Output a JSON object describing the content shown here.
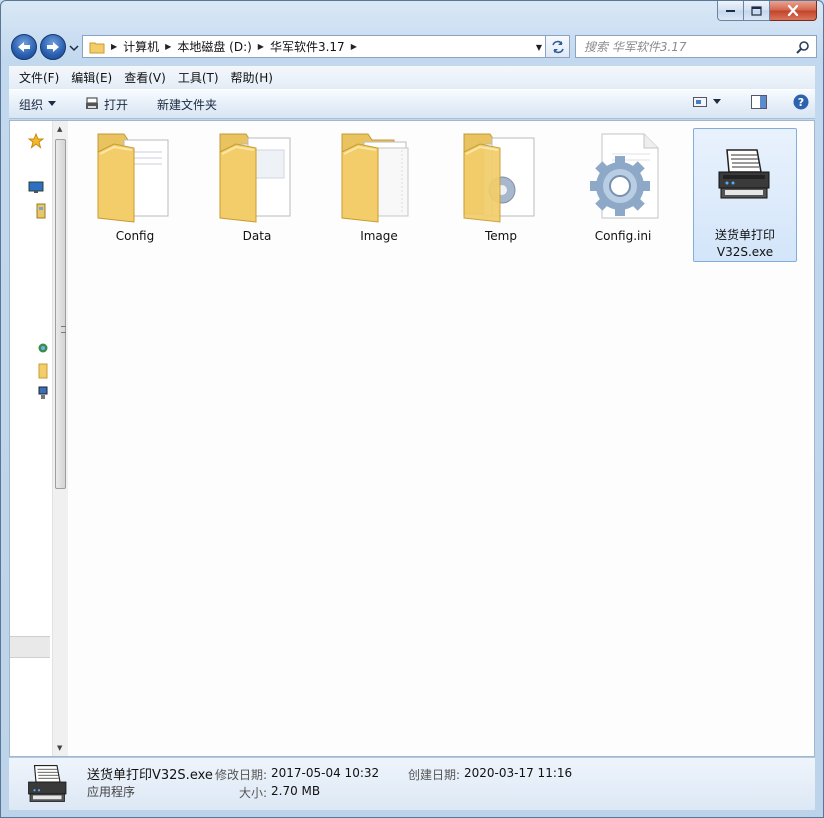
{
  "window": {
    "caption_buttons": [
      "minimize",
      "maximize",
      "close"
    ]
  },
  "address": {
    "crumbs": [
      "计算机",
      "本地磁盘 (D:)",
      "华军软件3.17"
    ]
  },
  "search": {
    "placeholder": "搜索 华军软件3.17"
  },
  "menu": [
    "文件(F)",
    "编辑(E)",
    "查看(V)",
    "工具(T)",
    "帮助(H)"
  ],
  "toolbar": {
    "organize": "组织",
    "open": "打开",
    "new_folder": "新建文件夹"
  },
  "files": [
    {
      "name": "Config",
      "kind": "folder",
      "icon": "folder-icon"
    },
    {
      "name": "Data",
      "kind": "folder",
      "icon": "folder-icon"
    },
    {
      "name": "Image",
      "kind": "folder",
      "icon": "folder-icon"
    },
    {
      "name": "Temp",
      "kind": "folder",
      "icon": "folder-gear-icon"
    },
    {
      "name": "Config.ini",
      "kind": "file",
      "icon": "settings-file-icon"
    },
    {
      "name": "送货单打印V32S.exe",
      "kind": "exe",
      "icon": "printer-icon",
      "selected": true
    }
  ],
  "details": {
    "name": "送货单打印V32S.exe",
    "type": "应用程序",
    "modified_label": "修改日期:",
    "modified": "2017-05-04 10:32",
    "created_label": "创建日期:",
    "created": "2020-03-17 11:16",
    "size_label": "大小:",
    "size": "2.70 MB"
  },
  "colors": {
    "selection_bg": "#d3e5fa",
    "selection_border": "#84acdd",
    "folder": "#f2cd6a"
  }
}
